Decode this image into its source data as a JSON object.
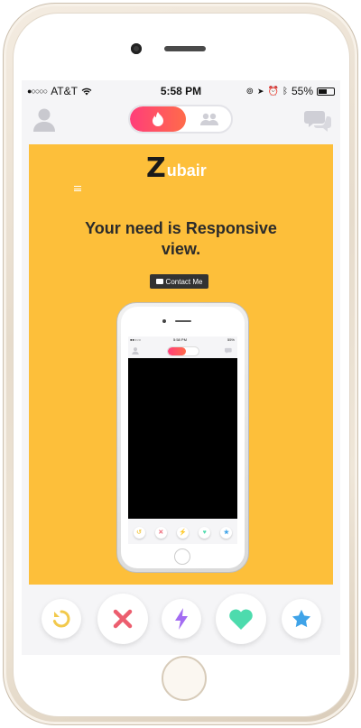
{
  "status_bar": {
    "carrier": "AT&T",
    "time": "5:58 PM",
    "battery": "55%"
  },
  "header": {
    "toggle_active": "flame",
    "toggle_inactive": "social"
  },
  "card": {
    "logo_letter": "Z",
    "logo_text": "ubair",
    "headline": "Your need is Responsive view.",
    "contact_label": "Contact Me",
    "mini_status": {
      "time": "5:58 PM",
      "battery": "55%"
    }
  },
  "actions": [
    {
      "name": "rewind",
      "icon": "undo-icon",
      "color": "#f2c94c"
    },
    {
      "name": "nope",
      "icon": "x-icon",
      "color": "#ec5e6f"
    },
    {
      "name": "boost",
      "icon": "lightning-icon",
      "color": "#a36cf2"
    },
    {
      "name": "like",
      "icon": "heart-icon",
      "color": "#4ddbad"
    },
    {
      "name": "super-like",
      "icon": "star-icon",
      "color": "#3fa3e8"
    }
  ],
  "colors": {
    "card_background": "#fdbf3a",
    "brand_gradient_start": "#ff3e7a",
    "brand_gradient_end": "#ff6b4a"
  }
}
